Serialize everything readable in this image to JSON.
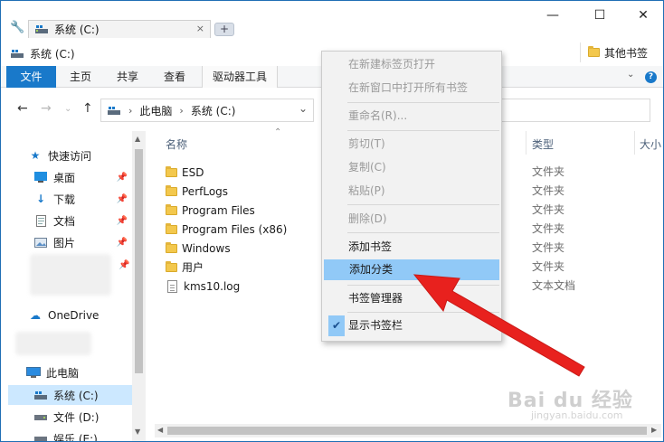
{
  "titlebar": {
    "tab_label": "系统 (C:)",
    "tab_close": "×",
    "new_tab": "+",
    "minimize": "—",
    "maximize": "☐",
    "close": "✕"
  },
  "bookmarks_bar": {
    "current": "系统 (C:)",
    "other": "其他书签"
  },
  "ribbon": {
    "tabs": [
      "文件",
      "主页",
      "共享",
      "查看",
      "驱动器工具"
    ],
    "help": "?"
  },
  "address": {
    "crumbs": [
      "此电脑",
      "系统 (C:)"
    ]
  },
  "nav_pane": {
    "quick_access": "快速访问",
    "items": [
      "桌面",
      "下载",
      "文档",
      "图片"
    ],
    "onedrive": "OneDrive",
    "this_pc": "此电脑",
    "drives": [
      "系统 (C:)",
      "文件 (D:)",
      "娱乐 (E:)"
    ]
  },
  "content": {
    "columns": {
      "name": "名称",
      "type": "类型",
      "size": "大小"
    },
    "rows": [
      {
        "name": "ESD",
        "type": "文件夹",
        "kind": "folder"
      },
      {
        "name": "PerfLogs",
        "type": "文件夹",
        "kind": "folder"
      },
      {
        "name": "Program Files",
        "type": "文件夹",
        "kind": "folder"
      },
      {
        "name": "Program Files (x86)",
        "type": "文件夹",
        "kind": "folder"
      },
      {
        "name": "Windows",
        "type": "文件夹",
        "kind": "folder"
      },
      {
        "name": "用户",
        "type": "文件夹",
        "kind": "folder"
      },
      {
        "name": "kms10.log",
        "type": "文本文档",
        "kind": "file"
      }
    ]
  },
  "context_menu": {
    "items": [
      {
        "label": "在新建标签页打开",
        "state": "disabled"
      },
      {
        "label": "在新窗口中打开所有书签",
        "state": "disabled"
      },
      {
        "label": "重命名(R)...",
        "state": "disabled"
      },
      {
        "label": "剪切(T)",
        "state": "disabled"
      },
      {
        "label": "复制(C)",
        "state": "disabled"
      },
      {
        "label": "粘贴(P)",
        "state": "disabled"
      },
      {
        "label": "删除(D)",
        "state": "disabled"
      },
      {
        "label": "添加书签",
        "state": "enabled"
      },
      {
        "label": "添加分类",
        "state": "highlighted"
      },
      {
        "label": "书签管理器",
        "state": "enabled"
      },
      {
        "label": "显示书签栏",
        "state": "checked"
      }
    ],
    "check_mark": "✔"
  },
  "watermark": {
    "text": "Bai du 经验",
    "sub": "jingyan.baidu.com"
  },
  "colors": {
    "accent": "#1979ca",
    "highlight": "#91c9f7",
    "selection": "#cce8ff",
    "arrow": "#e8211e"
  }
}
